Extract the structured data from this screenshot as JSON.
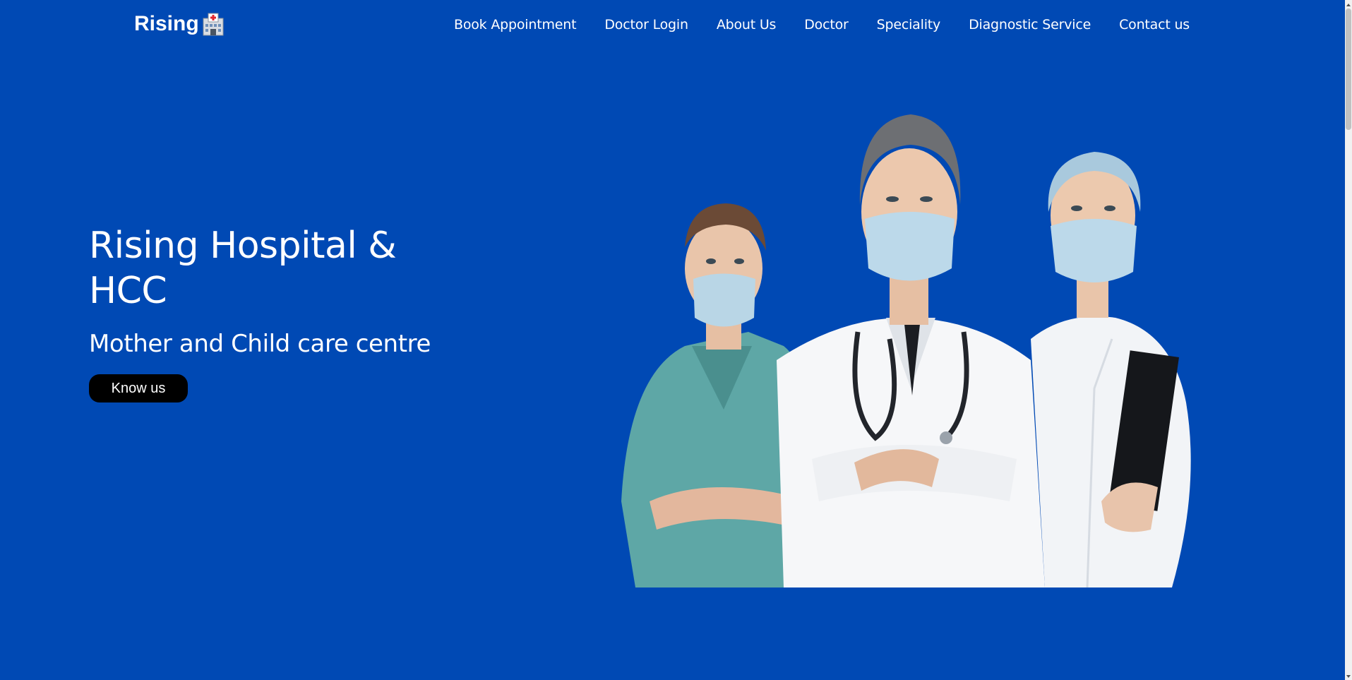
{
  "header": {
    "logo_text": "Rising",
    "logo_icon": "hospital-icon",
    "nav": [
      {
        "label": "Book Appointment"
      },
      {
        "label": "Doctor Login"
      },
      {
        "label": "About Us"
      },
      {
        "label": "Doctor"
      },
      {
        "label": "Speciality"
      },
      {
        "label": "Diagnostic Service"
      },
      {
        "label": "Contact us"
      }
    ]
  },
  "hero": {
    "title": "Rising Hospital & HCC",
    "subtitle": "Mother and Child care centre",
    "button_label": "Know us",
    "image": "three medical staff in masks, arms crossed"
  },
  "colors": {
    "background": "#0049b4",
    "text": "#ffffff",
    "button": "#000000"
  }
}
